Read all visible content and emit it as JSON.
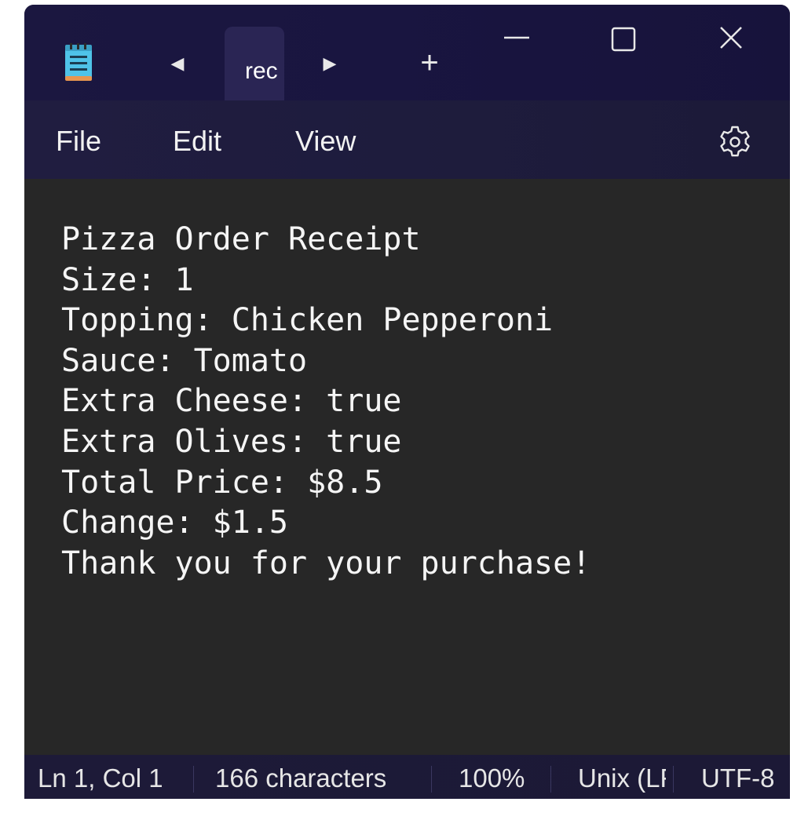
{
  "titlebar": {
    "tab_label": "rec",
    "new_tab_glyph": "+",
    "prev_glyph": "◀",
    "next_glyph": "▶",
    "icons": {
      "app": "notepad-icon",
      "minimize": "minimize-icon",
      "maximize": "maximize-icon",
      "close": "close-icon"
    }
  },
  "menu": {
    "file": "File",
    "edit": "Edit",
    "view": "View",
    "settings_icon": "gear-icon"
  },
  "editor": {
    "lines": [
      "Pizza Order Receipt",
      "Size: 1",
      "Topping: Chicken Pepperoni",
      "Sauce: Tomato",
      "Extra Cheese: true",
      "Extra Olives: true",
      "Total Price: $8.5",
      "Change: $1.5",
      "Thank you for your purchase!"
    ]
  },
  "status": {
    "position": "Ln 1, Col 1",
    "characters": "166 characters",
    "zoom": "100%",
    "line_ending": "Unix (LF)",
    "encoding": "UTF-8"
  },
  "colors": {
    "titlebar": "#1b1740",
    "tab": "#2a2554",
    "menubar": "#201d40",
    "editor_bg": "#272727",
    "text": "#f5f5f5",
    "app_icon": "#4fc3e8"
  }
}
